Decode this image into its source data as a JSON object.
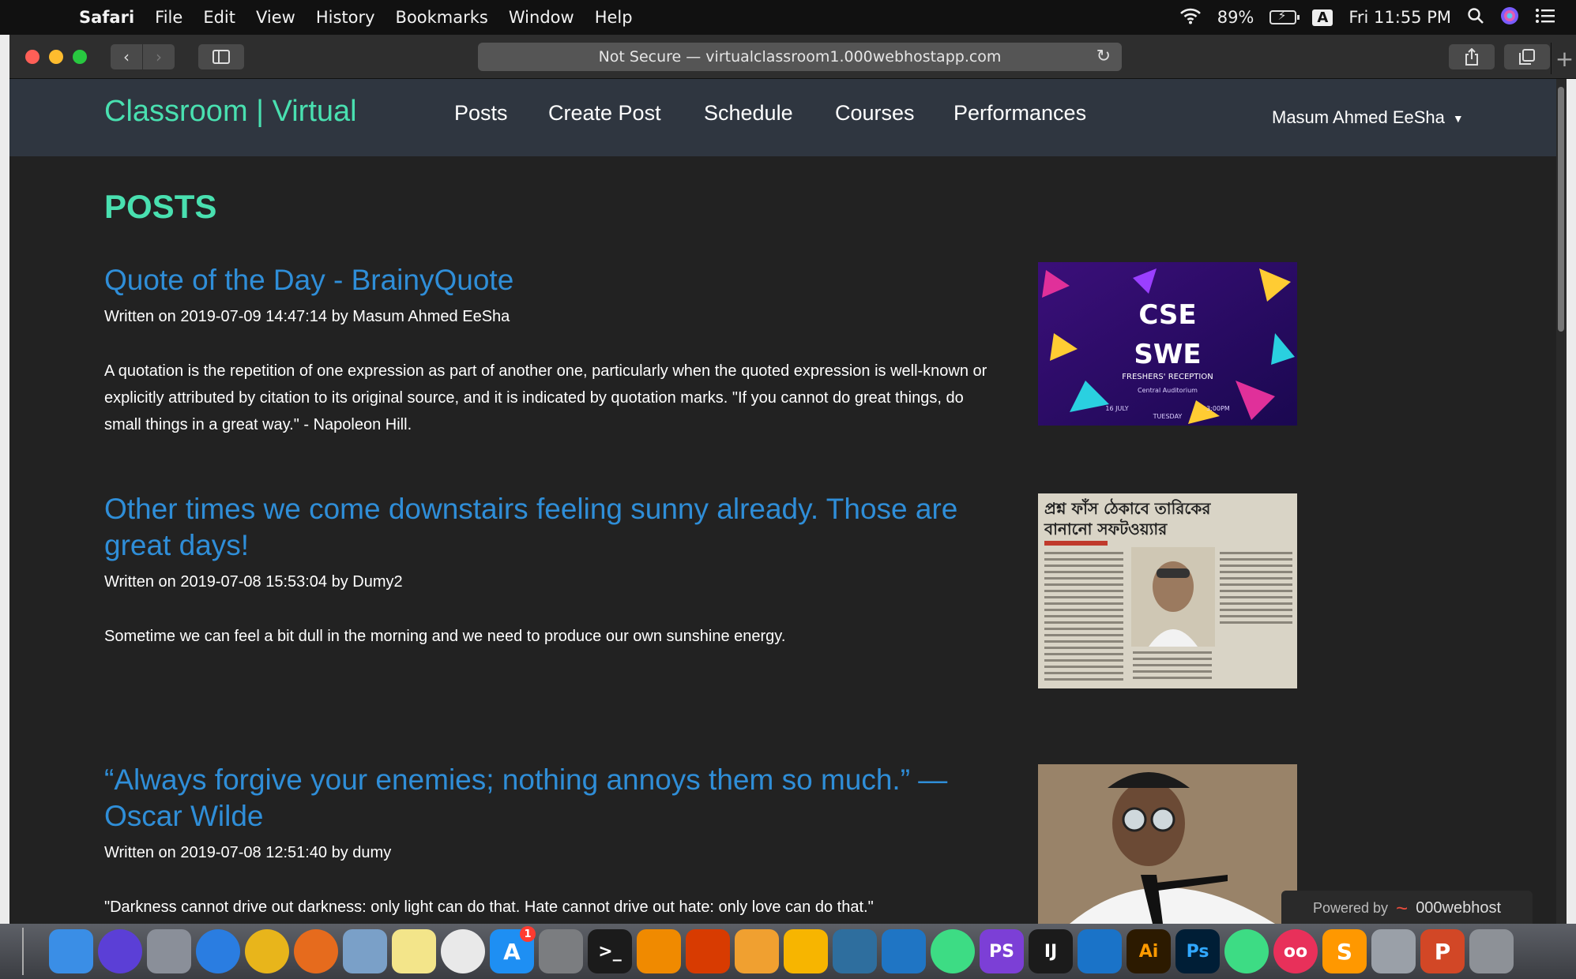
{
  "menubar": {
    "app": "Safari",
    "menus": [
      "File",
      "Edit",
      "View",
      "History",
      "Bookmarks",
      "Window",
      "Help"
    ],
    "battery": "89%",
    "input_source": "A",
    "clock": "Fri 11:55 PM"
  },
  "browser": {
    "url": "Not Secure — virtualclassroom1.000webhostapp.com"
  },
  "site": {
    "brand": "Classroom | Virtual",
    "nav": [
      "Posts",
      "Create Post",
      "Schedule",
      "Courses",
      "Performances"
    ],
    "user": "Masum Ahmed EeSha",
    "heading": "POSTS"
  },
  "posts": [
    {
      "title": "Quote of the Day - BrainyQuote",
      "meta": "Written on 2019-07-09 14:47:14 by Masum Ahmed EeSha",
      "body": "A quotation is the repetition of one expression as part of another one, particularly when the quoted expression is well-known or explicitly attributed by citation to its original source, and it is indicated by quotation marks. \"If you cannot do great things, do small things in a great way.\" - Napoleon Hill.",
      "thumb": {
        "line1": "CSE",
        "line2": "SWE",
        "caption": "FRESHERS' RECEPTION",
        "sub": "Central Auditorium",
        "day": "TUESDAY",
        "time": "3:00PM",
        "date": "16 JULY"
      }
    },
    {
      "title": "Other times we come downstairs feeling sunny already. Those are great days!",
      "meta": "Written on 2019-07-08 15:53:04 by Dumy2",
      "body": "Sometime we can feel a bit dull in the morning and we need to produce our own sunshine energy.",
      "thumb": {
        "headline1": "প্রশ্ন ফাঁস ঠেকাবে তারিকের",
        "headline2": "বানানো সফটওয়্যার"
      }
    },
    {
      "title": "“Always forgive your enemies; nothing annoys them so much.” — Oscar Wilde",
      "meta": "Written on 2019-07-08 12:51:40 by dumy",
      "body": "\"Darkness cannot drive out darkness: only light can do that. Hate cannot drive out hate: only love can do that.\""
    }
  ],
  "footer": {
    "powered_by": "Powered by",
    "host": "000webhost"
  },
  "dock": {
    "apps": [
      {
        "name": "finder",
        "color": "#3a8ee6",
        "label": ""
      },
      {
        "name": "siri",
        "color": "#5b3fd6",
        "label": ""
      },
      {
        "name": "launchpad",
        "color": "#8a8f99",
        "label": ""
      },
      {
        "name": "safari",
        "color": "#2a7de1",
        "label": ""
      },
      {
        "name": "chrome",
        "color": "#e8b51b",
        "label": ""
      },
      {
        "name": "firefox",
        "color": "#e66b1d",
        "label": ""
      },
      {
        "name": "preview",
        "color": "#7aa0c8",
        "label": ""
      },
      {
        "name": "notes",
        "color": "#f3e58a",
        "label": ""
      },
      {
        "name": "photos",
        "color": "#e9e9e9",
        "label": ""
      },
      {
        "name": "app-store",
        "color": "#1e8ff3",
        "label": "A",
        "badge": "1"
      },
      {
        "name": "system-preferences",
        "color": "#7b7d80",
        "label": ""
      },
      {
        "name": "terminal",
        "color": "#1b1b1b",
        "label": ">_"
      },
      {
        "name": "vlc",
        "color": "#f08a00",
        "label": ""
      },
      {
        "name": "windows",
        "color": "#d83b01",
        "label": ""
      },
      {
        "name": "tableplus",
        "color": "#f0a030",
        "label": ""
      },
      {
        "name": "sketch",
        "color": "#f7b500",
        "label": ""
      },
      {
        "name": "mysql-workbench",
        "color": "#2e6e9e",
        "label": ""
      },
      {
        "name": "vscode",
        "color": "#1f75c4",
        "label": ""
      },
      {
        "name": "android-studio",
        "color": "#3ddc84",
        "label": ""
      },
      {
        "name": "phpstorm",
        "color": "#7c3fd6",
        "label": "PS"
      },
      {
        "name": "intellij",
        "color": "#1b1b1b",
        "label": "IJ"
      },
      {
        "name": "xcode",
        "color": "#1a73c8",
        "label": ""
      },
      {
        "name": "illustrator",
        "color": "#2c1a00",
        "label": "Ai"
      },
      {
        "name": "photoshop",
        "color": "#001e36",
        "label": "Ps"
      },
      {
        "name": "android-file",
        "color": "#3ddc84",
        "label": ""
      },
      {
        "name": "oo-app",
        "color": "#e8305a",
        "label": "oo"
      },
      {
        "name": "sublime-text",
        "color": "#ff9800",
        "label": "S"
      },
      {
        "name": "archive-utility",
        "color": "#9aa0a8",
        "label": ""
      },
      {
        "name": "powerpoint",
        "color": "#d24726",
        "label": "P"
      },
      {
        "name": "trash",
        "color": "#8d9197",
        "label": ""
      }
    ]
  }
}
